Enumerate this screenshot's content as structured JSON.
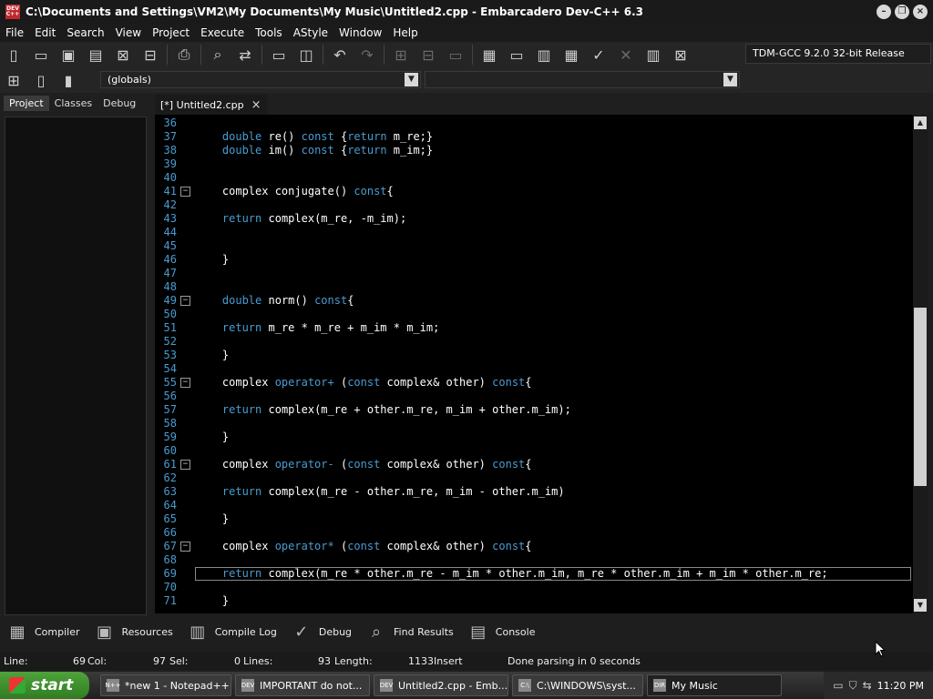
{
  "window": {
    "title": "C:\\Documents and Settings\\VM2\\My Documents\\My Music\\Untitled2.cpp - Embarcadero Dev-C++ 6.3",
    "app_icon": "DEV C++"
  },
  "menu": [
    "File",
    "Edit",
    "Search",
    "View",
    "Project",
    "Execute",
    "Tools",
    "AStyle",
    "Window",
    "Help"
  ],
  "toolbar": {
    "compiler": "TDM-GCC 9.2.0 32-bit Release",
    "scope": "(globals)"
  },
  "left_panel": {
    "tabs": [
      "Project",
      "Classes",
      "Debug"
    ]
  },
  "editor": {
    "tab_label": "[*] Untitled2.cpp",
    "lines": [
      {
        "n": "36",
        "text": ""
      },
      {
        "n": "37",
        "text": "    double re() const {return m_re;}"
      },
      {
        "n": "38",
        "text": "    double im() const {return m_im;}"
      },
      {
        "n": "39",
        "text": ""
      },
      {
        "n": "40",
        "text": ""
      },
      {
        "n": "41",
        "text": "    complex conjugate() const{",
        "fold": true
      },
      {
        "n": "42",
        "text": ""
      },
      {
        "n": "43",
        "text": "    return complex(m_re, -m_im);"
      },
      {
        "n": "44",
        "text": ""
      },
      {
        "n": "45",
        "text": ""
      },
      {
        "n": "46",
        "text": "    }"
      },
      {
        "n": "47",
        "text": ""
      },
      {
        "n": "48",
        "text": ""
      },
      {
        "n": "49",
        "text": "    double norm() const{",
        "fold": true
      },
      {
        "n": "50",
        "text": ""
      },
      {
        "n": "51",
        "text": "    return m_re * m_re + m_im * m_im;"
      },
      {
        "n": "52",
        "text": ""
      },
      {
        "n": "53",
        "text": "    }"
      },
      {
        "n": "54",
        "text": ""
      },
      {
        "n": "55",
        "text": "    complex operator+ (const complex& other) const{",
        "fold": true
      },
      {
        "n": "56",
        "text": ""
      },
      {
        "n": "57",
        "text": "    return complex(m_re + other.m_re, m_im + other.m_im);"
      },
      {
        "n": "58",
        "text": ""
      },
      {
        "n": "59",
        "text": "    }"
      },
      {
        "n": "60",
        "text": ""
      },
      {
        "n": "61",
        "text": "    complex operator- (const complex& other) const{",
        "fold": true
      },
      {
        "n": "62",
        "text": ""
      },
      {
        "n": "63",
        "text": "    return complex(m_re - other.m_re, m_im - other.m_im)"
      },
      {
        "n": "64",
        "text": ""
      },
      {
        "n": "65",
        "text": "    }"
      },
      {
        "n": "66",
        "text": ""
      },
      {
        "n": "67",
        "text": "    complex operator* (const complex& other) const{",
        "fold": true
      },
      {
        "n": "68",
        "text": ""
      },
      {
        "n": "69",
        "text": "    return complex(m_re * other.m_re - m_im * other.m_im, m_re * other.m_im + m_im * other.m_re;",
        "current": true
      },
      {
        "n": "70",
        "text": ""
      },
      {
        "n": "71",
        "text": "    }"
      }
    ]
  },
  "bottom_tabs": [
    {
      "label": "Compiler",
      "icon": "grid-icon"
    },
    {
      "label": "Resources",
      "icon": "resources-icon"
    },
    {
      "label": "Compile Log",
      "icon": "bar-chart-icon"
    },
    {
      "label": "Debug",
      "icon": "check-icon"
    },
    {
      "label": "Find Results",
      "icon": "find-icon"
    },
    {
      "label": "Console",
      "icon": "console-icon"
    }
  ],
  "status": {
    "line_label": "Line:",
    "line_value": "69",
    "col_label": "Col:",
    "col_value": "97",
    "sel_label": "Sel:",
    "sel_value": "0",
    "lines_label": "Lines:",
    "lines_value": "93",
    "length_label": "Length:",
    "length_value": "1133",
    "mode": "Insert",
    "message": "Done parsing in 0 seconds"
  },
  "taskbar": {
    "start": "start",
    "tasks": [
      {
        "label": "*new 1 - Notepad++",
        "icon": "N++"
      },
      {
        "label": "IMPORTANT do not...",
        "icon": "DEV"
      },
      {
        "label": "Untitled2.cpp - Emb...",
        "icon": "DEV"
      },
      {
        "label": "C:\\WINDOWS\\syst...",
        "icon": "C:\\"
      },
      {
        "label": "My Music",
        "icon": "DIR",
        "active": true
      }
    ],
    "clock": "11:20 PM"
  }
}
